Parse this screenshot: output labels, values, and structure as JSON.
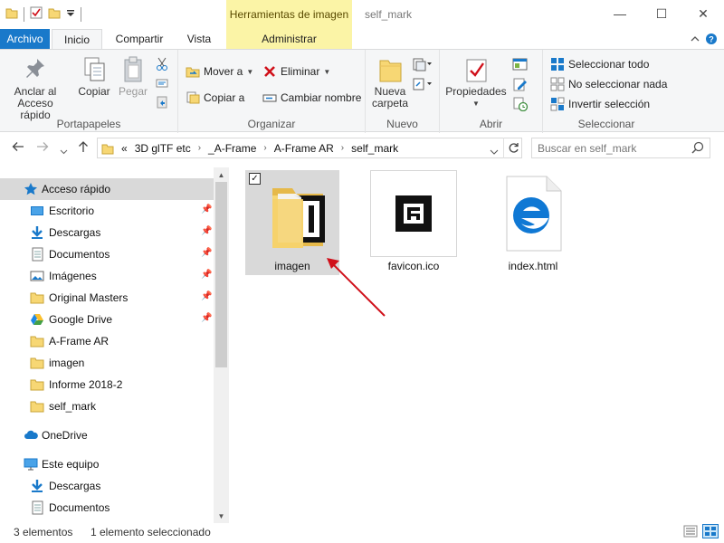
{
  "window": {
    "title": "self_mark",
    "context_tab_header": "Herramientas de imagen",
    "controls": {
      "minimize": "—",
      "maximize": "☐",
      "close": "✕"
    }
  },
  "ribbon_tabs": [
    {
      "label": "Archivo"
    },
    {
      "label": "Inicio"
    },
    {
      "label": "Compartir"
    },
    {
      "label": "Vista"
    },
    {
      "label": "Administrar"
    }
  ],
  "ribbon": {
    "portapapeles": {
      "group_label": "Portapapeles",
      "pin_label_1": "Anclar al",
      "pin_label_2": "Acceso rápido",
      "copy": "Copiar",
      "paste": "Pegar"
    },
    "organizar": {
      "group_label": "Organizar",
      "move_to": "Mover a",
      "copy_to": "Copiar a",
      "delete": "Eliminar",
      "rename": "Cambiar nombre"
    },
    "nuevo": {
      "group_label": "Nuevo",
      "new_folder_1": "Nueva",
      "new_folder_2": "carpeta"
    },
    "abrir": {
      "group_label": "Abrir",
      "properties": "Propiedades"
    },
    "seleccionar": {
      "group_label": "Seleccionar",
      "select_all": "Seleccionar todo",
      "select_none": "No seleccionar nada",
      "invert": "Invertir selección"
    }
  },
  "address": {
    "overflow": "«",
    "crumbs": [
      "3D glTF etc",
      "_A-Frame",
      "A-Frame AR",
      "self_mark"
    ],
    "search_placeholder": "Buscar en self_mark"
  },
  "nav_pane": {
    "quick_access": "Acceso rápido",
    "items": [
      {
        "label": "Escritorio",
        "icon": "desktop-icon",
        "pinned": true
      },
      {
        "label": "Descargas",
        "icon": "download-icon",
        "pinned": true
      },
      {
        "label": "Documentos",
        "icon": "document-icon",
        "pinned": true
      },
      {
        "label": "Imágenes",
        "icon": "pictures-icon",
        "pinned": true
      },
      {
        "label": "Original Masters",
        "icon": "folder-icon",
        "pinned": true
      },
      {
        "label": "Google Drive",
        "icon": "google-drive-icon",
        "pinned": true
      },
      {
        "label": "A-Frame AR",
        "icon": "folder-icon",
        "pinned": false
      },
      {
        "label": "imagen",
        "icon": "folder-icon",
        "pinned": false
      },
      {
        "label": "Informe 2018-2",
        "icon": "folder-icon",
        "pinned": false
      },
      {
        "label": "self_mark",
        "icon": "folder-icon",
        "pinned": false
      }
    ],
    "onedrive": "OneDrive",
    "this_pc": "Este equipo",
    "pc_items": [
      {
        "label": "Descargas",
        "icon": "download-icon"
      },
      {
        "label": "Documentos",
        "icon": "document-icon"
      }
    ]
  },
  "files": [
    {
      "name": "imagen",
      "type": "folder",
      "selected": true
    },
    {
      "name": "favicon.ico",
      "type": "ico",
      "selected": false
    },
    {
      "name": "index.html",
      "type": "html",
      "selected": false
    }
  ],
  "status": {
    "count": "3 elementos",
    "selection": "1 elemento seleccionado"
  },
  "colors": {
    "accent": "#1979ca",
    "context_tab": "#fbf4a6",
    "selection": "#d9d9d9",
    "folder": "#f7d774",
    "arrow": "#d0101a",
    "edge_blue": "#0f78d4"
  }
}
